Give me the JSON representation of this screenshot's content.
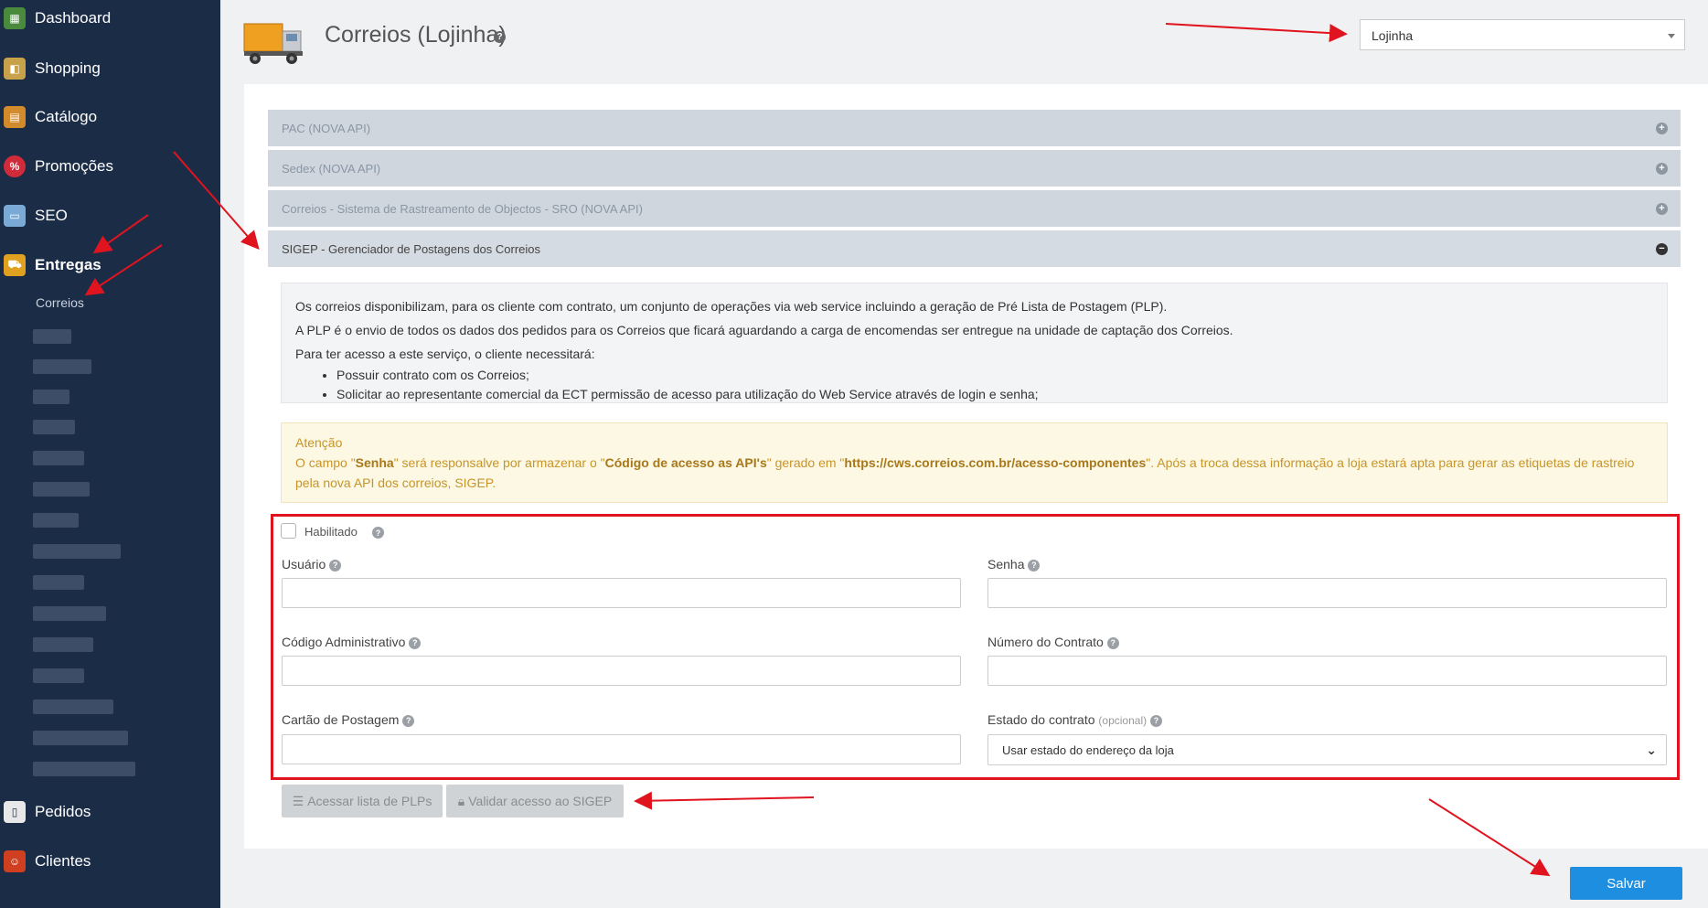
{
  "sidebar": {
    "items": [
      {
        "label": "Dashboard",
        "icon": "dashboard-icon",
        "color": "#4a8a3c"
      },
      {
        "label": "Shopping",
        "icon": "shopping-icon",
        "color": "#c8a24a"
      },
      {
        "label": "Catálogo",
        "icon": "catalog-icon",
        "color": "#d28a2a"
      },
      {
        "label": "Promoções",
        "icon": "promotions-icon",
        "color": "#d12a3a"
      },
      {
        "label": "SEO",
        "icon": "seo-icon",
        "color": "#7aa9d6"
      },
      {
        "label": "Entregas",
        "icon": "delivery-truck-icon",
        "color": "#e0a020"
      },
      {
        "label": "Pedidos",
        "icon": "orders-icon",
        "color": "#e8e8e8"
      },
      {
        "label": "Clientes",
        "icon": "customers-icon",
        "color": "#d04020"
      }
    ],
    "sub_item": "Correios"
  },
  "header": {
    "title": "Correios (Lojinha)",
    "help": "?",
    "store_select": "Lojinha"
  },
  "accordion": [
    {
      "label": "PAC (NOVA API)",
      "toggle": "+"
    },
    {
      "label": "Sedex (NOVA API)",
      "toggle": "+"
    },
    {
      "label": "Correios - Sistema de Rastreamento de Objectos - SRO (NOVA API)",
      "toggle": "+"
    },
    {
      "label": "SIGEP - Gerenciador de Postagens dos Correios",
      "toggle": "−"
    }
  ],
  "info": {
    "line1": "Os correios disponibilizam, para os cliente com contrato, um conjunto de operações via web service incluindo a geração de Pré Lista de Postagem (PLP).",
    "line2": "A PLP é o envio de todos os dados dos pedidos para os Correios que ficará aguardando a carga de encomendas ser entregue na unidade de captação dos Correios.",
    "line3": "Para ter acesso a este serviço, o cliente necessitará:",
    "bullet1": "Possuir contrato com os Correios;",
    "bullet2": "Solicitar ao representante comercial da ECT permissão de acesso para utilização do Web Service através de login e senha;"
  },
  "warning": {
    "title": "Atenção",
    "p1": "O campo \"",
    "b1": "Senha",
    "p2": "\" será responsalve por armazenar o \"",
    "b2": "Código de acesso as API's",
    "p3": "\" gerado em \"",
    "b3": "https://cws.correios.com.br/acesso-componentes",
    "p4": "\". Após a troca dessa informação a loja estará apta para gerar as etiquetas de rastreio pela nova API dos correios, SIGEP."
  },
  "form": {
    "enabled_label": "Habilitado",
    "user_label": "Usuário",
    "password_label": "Senha",
    "admin_code_label": "Código Administrativo",
    "contract_number_label": "Número do Contrato",
    "posting_card_label": "Cartão de Postagem",
    "contract_state_label": "Estado do contrato",
    "contract_state_optional": "(opcional)",
    "contract_state_value": "Usar estado do endereço da loja"
  },
  "buttons": {
    "plp_list": "Acessar lista de PLPs",
    "validate": "Validar acesso ao SIGEP",
    "save": "Salvar"
  },
  "colors": {
    "sidebar": "#1b2c47",
    "accent": "#1e8ee0",
    "annotation": "#e0141e",
    "warning_text": "#c79529"
  }
}
